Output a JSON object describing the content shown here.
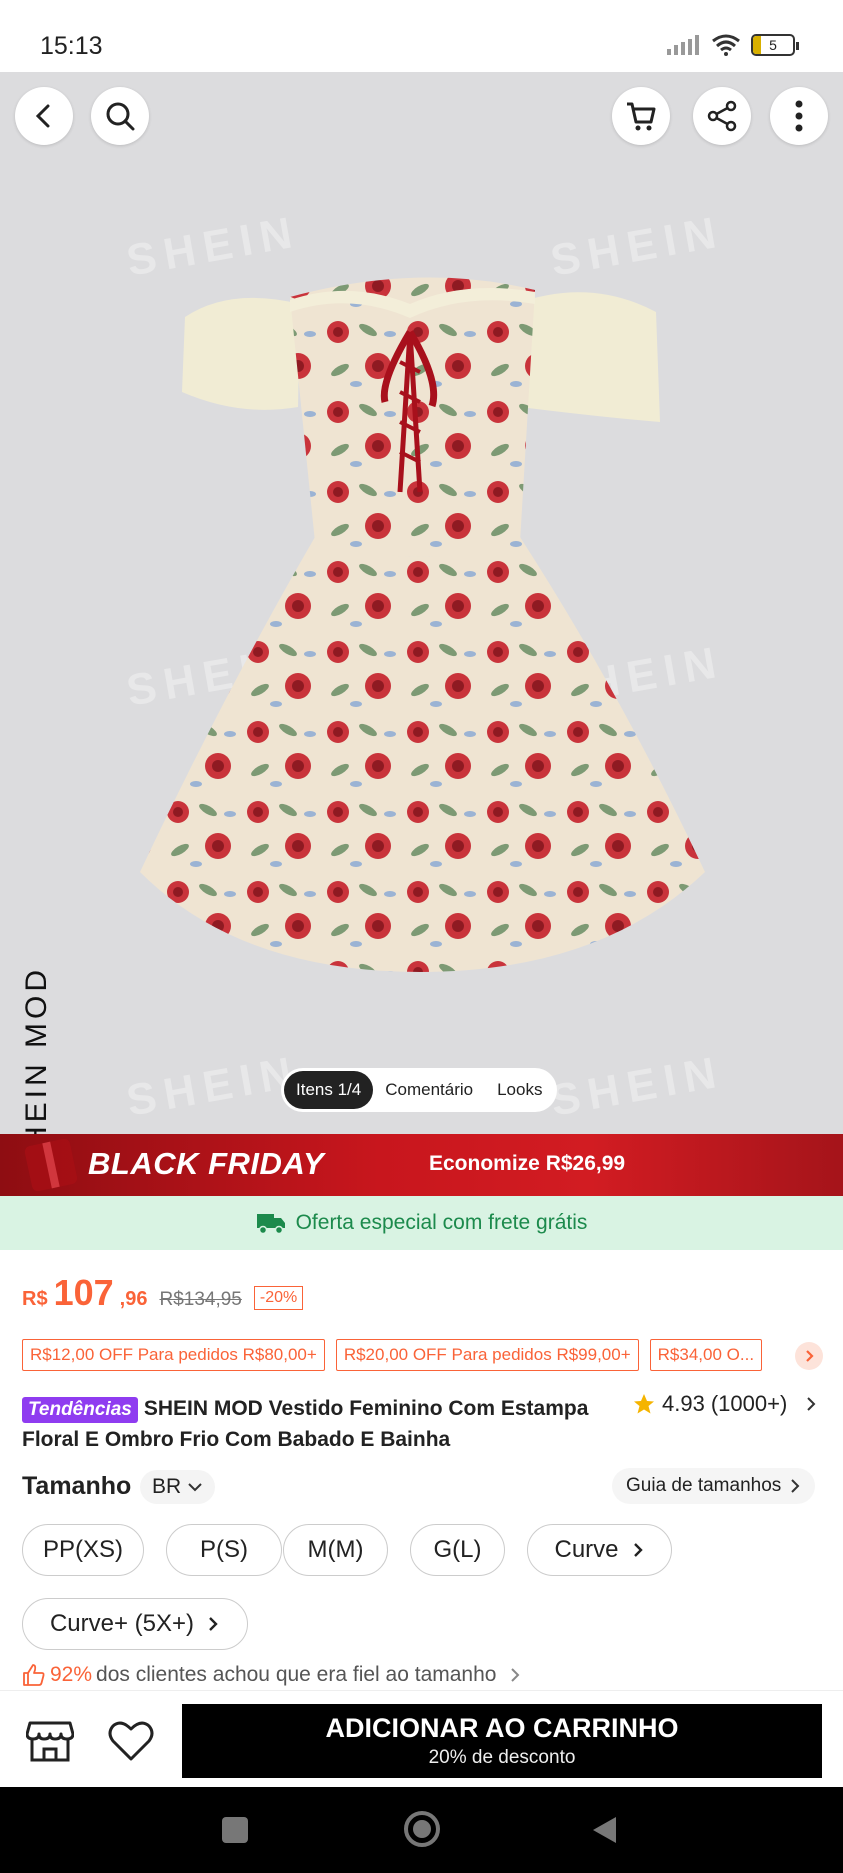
{
  "status_bar": {
    "time": "15:13",
    "battery": "5"
  },
  "hero": {
    "watermark": "SHEIN",
    "brand": "SHEIN MOD",
    "tabs": [
      {
        "label": "Itens 1/4"
      },
      {
        "label": "Comentário"
      },
      {
        "label": "Looks"
      }
    ]
  },
  "banner": {
    "title": "BLACK FRIDAY",
    "savings": "Economize R$26,99"
  },
  "shipping": {
    "text": "Oferta especial com frete grátis"
  },
  "price": {
    "currency": "R$",
    "integer": "107",
    "decimal": ",96",
    "original": "R$134,95",
    "discount": "-20%"
  },
  "coupons": [
    "R$12,00 OFF Para pedidos R$80,00+",
    "R$20,00 OFF Para pedidos R$99,00+",
    "R$34,00 O..."
  ],
  "product": {
    "badge": "Tendências",
    "title": "SHEIN MOD Vestido Feminino Com Estampa Floral E Ombro Frio Com Babado E Bainha",
    "rating": "4.93",
    "review_count": "(1000+)"
  },
  "size": {
    "label": "Tamanho",
    "region": "BR",
    "guide": "Guia de tamanhos",
    "options": [
      "PP(XS)",
      "P(S)",
      "M(M)",
      "G(L)",
      "Curve",
      "Curve+ (5X+)"
    ]
  },
  "fit": {
    "percent": "92%",
    "text": "dos clientes achou que era fiel ao tamanho"
  },
  "action": {
    "add_to_cart": "ADICIONAR AO CARRINHO",
    "add_to_cart_sub": "20% de desconto"
  },
  "colors": {
    "accent": "#fa6338",
    "banner_red": "#c8161d",
    "shipping_green": "#1c8a4c",
    "badge_purple": "#8f3cf0"
  }
}
